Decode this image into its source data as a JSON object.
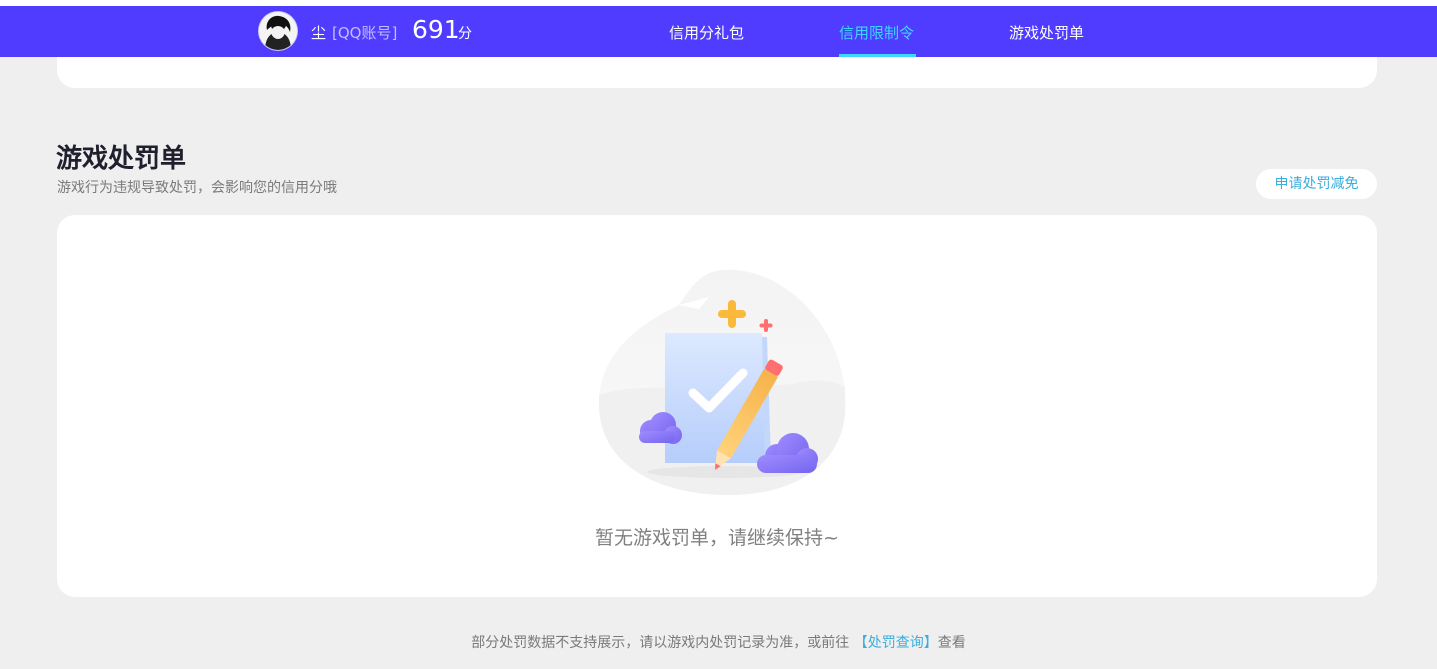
{
  "colors": {
    "nav_bg": "#4f3cff",
    "active_tab": "#3cd6ff",
    "page_bg": "#efefef",
    "link": "#3aaedc"
  },
  "header": {
    "avatar_icon": "user-avatar",
    "username": "尘",
    "account_type": "[QQ账号]",
    "score": "691",
    "score_unit": "分",
    "tabs": [
      {
        "label": "信用分礼包",
        "active": false
      },
      {
        "label": "信用限制令",
        "active": true
      },
      {
        "label": "游戏处罚单",
        "active": false
      }
    ]
  },
  "section": {
    "title": "游戏处罚单",
    "subtitle": "游戏行为违规导致处罚，会影响您的信用分哦",
    "appeal_button": "申请处罚减免"
  },
  "empty_state": {
    "illustration_icon": "document-check-pencil-illustration",
    "text": "暂无游戏罚单，请继续保持~"
  },
  "footer": {
    "text_before": "部分处罚数据不支持展示，请以游戏内处罚记录为准，或前往",
    "link": "【处罚查询】",
    "text_after": "查看"
  }
}
